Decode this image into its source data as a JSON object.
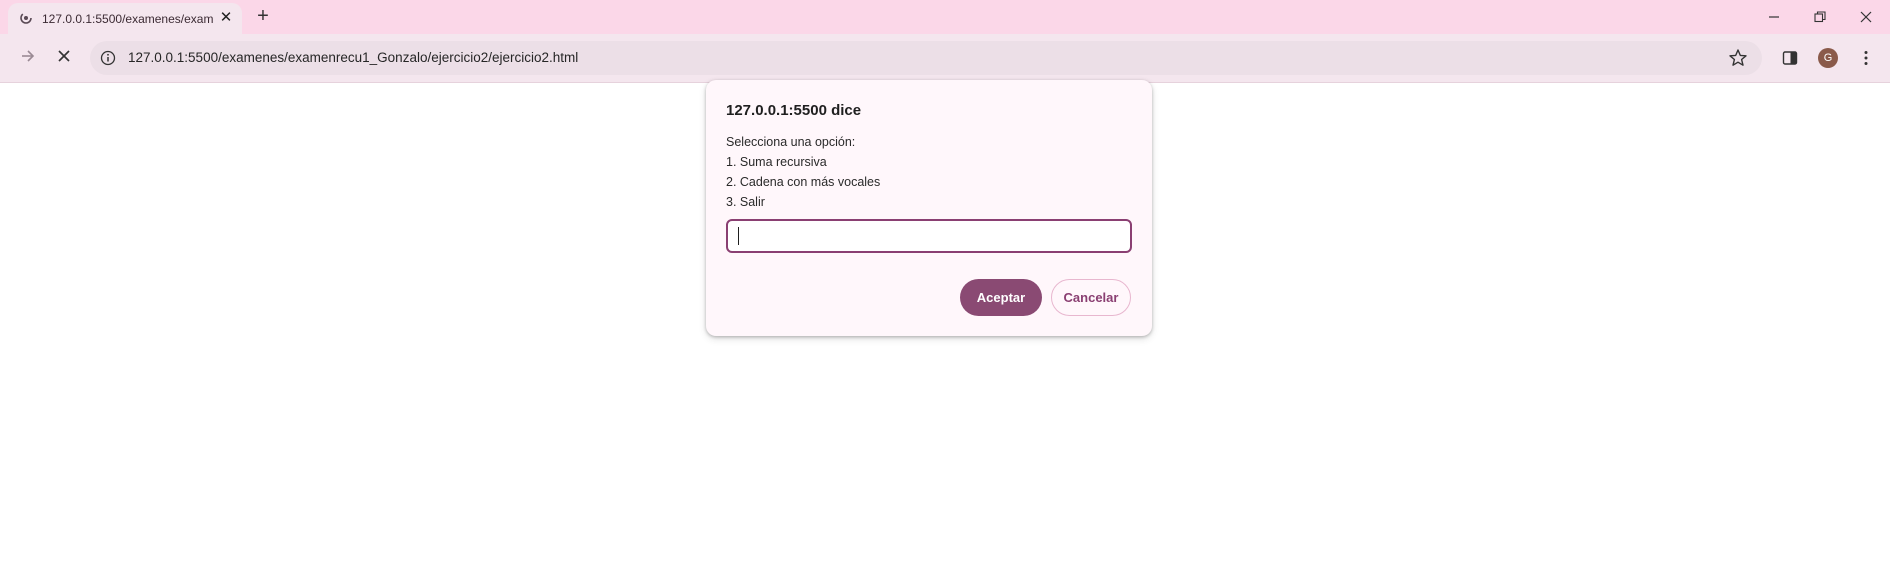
{
  "browser": {
    "tab": {
      "title": "127.0.0.1:5500/examenes/exam",
      "favicon": "loading-spinner-icon",
      "close_icon": "close-icon"
    },
    "new_tab_label": "+",
    "window_controls": [
      "minimize-icon",
      "restore-icon",
      "close-icon"
    ],
    "toolbar": {
      "back_icon": "arrow-left-icon",
      "forward_icon": "arrow-right-icon",
      "stop_icon": "stop-icon",
      "url": "127.0.0.1:5500/examenes/examenrecu1_Gonzalo/ejercicio2/ejercicio2.html",
      "site_info_icon": "info-icon",
      "bookmark_icon": "star-icon",
      "side_panel_icon": "side-panel-icon",
      "profile_initial": "G",
      "menu_icon": "kebab-menu-icon"
    }
  },
  "dialog": {
    "title": "127.0.0.1:5500 dice",
    "message_lines": [
      "Selecciona una opción:",
      "1. Suma recursiva",
      "2. Cadena con más vocales",
      "3. Salir"
    ],
    "input_value": "",
    "ok_label": "Aceptar",
    "cancel_label": "Cancelar"
  },
  "colors": {
    "tabstrip_bg": "#fbd7e8",
    "toolbar_bg": "#f4e6ee",
    "accent": "#8a4a73",
    "dialog_bg": "#fff7fb"
  }
}
